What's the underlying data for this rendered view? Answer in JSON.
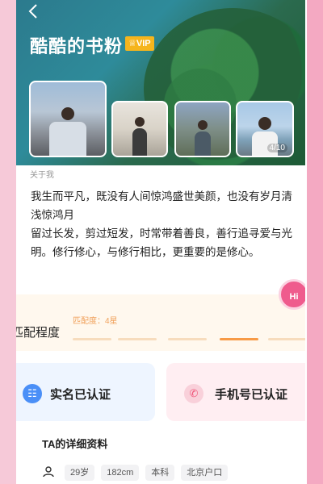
{
  "header": {
    "title": "酷酷的书粉",
    "vip_label": "VIP",
    "back_icon": "chevron-left-icon",
    "photo_count": "4/10"
  },
  "about": {
    "label": "关于我",
    "bio_lines": [
      "我生而平凡，既没有人间惊鸿盛世美颜，也没有岁月清浅惊鸿月",
      "留过长发，剪过短发，时常带着善良，善行追寻爱与光明。修行修心，与修行相比，更重要的是修心。"
    ]
  },
  "match": {
    "title": "匹配程度",
    "subtitle": "匹配度：4星",
    "stars_total": 5,
    "stars_active": 4,
    "accent": "#f79a46"
  },
  "hi_button": {
    "label": "Hi"
  },
  "verify": {
    "id": {
      "label": "实名已认证",
      "icon": "id-card-icon"
    },
    "phone": {
      "label": "手机号已认证",
      "icon": "phone-icon"
    }
  },
  "details": {
    "title": "TA的详细资料",
    "tags": [
      "29岁",
      "182cm",
      "本科",
      "北京户口"
    ]
  },
  "colors": {
    "accent_pink": "#ef5b8d",
    "vip": "#f5b51d",
    "verify_blue": "#4a8ff7"
  }
}
